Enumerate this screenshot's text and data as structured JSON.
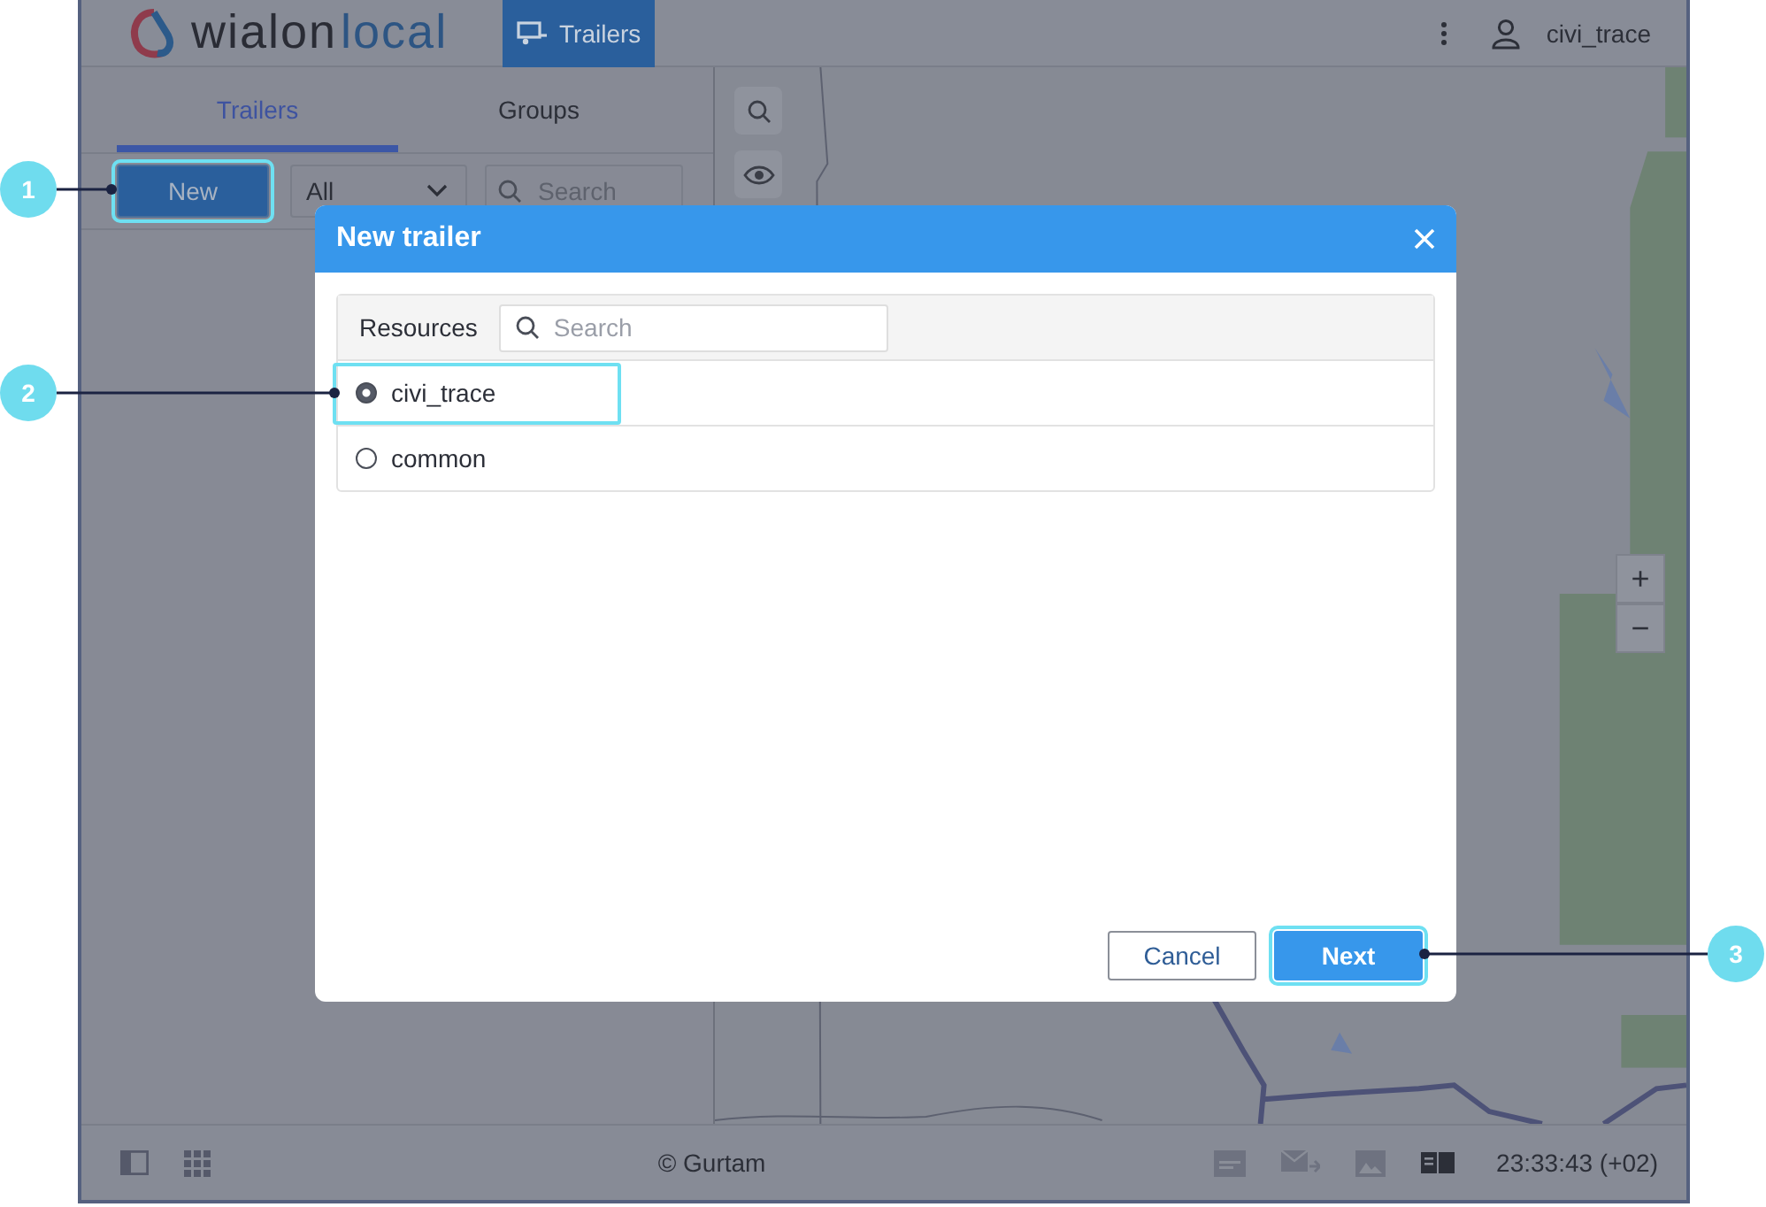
{
  "header": {
    "logo": {
      "dark": "wialon",
      "light": "local"
    },
    "nav_tabs": [
      {
        "label": "Trailers",
        "selected": true
      }
    ],
    "user": "civi_trace"
  },
  "panel": {
    "tabs": [
      {
        "label": "Trailers",
        "selected": true
      },
      {
        "label": "Groups",
        "selected": false
      }
    ],
    "new_button": "New",
    "filter": "All",
    "search": {
      "placeholder": "Search"
    }
  },
  "map": {
    "kind": "picture",
    "zoom_buttons": [
      "+",
      "−"
    ]
  },
  "footer": {
    "copyright": "© Gurtam",
    "time": "23:33:43 (+02)"
  },
  "dialog": {
    "title": "New trailer",
    "resources_label": "Resources",
    "search": {
      "placeholder": "Search"
    },
    "resources": [
      {
        "name": "civi_trace",
        "selected": true
      },
      {
        "name": "common",
        "selected": false
      }
    ],
    "buttons": [
      {
        "label": "Cancel",
        "kind": "secondary"
      },
      {
        "label": "Next",
        "kind": "primary"
      }
    ]
  },
  "callouts": [
    {
      "number": "1"
    },
    {
      "number": "2"
    },
    {
      "number": "3"
    }
  ]
}
